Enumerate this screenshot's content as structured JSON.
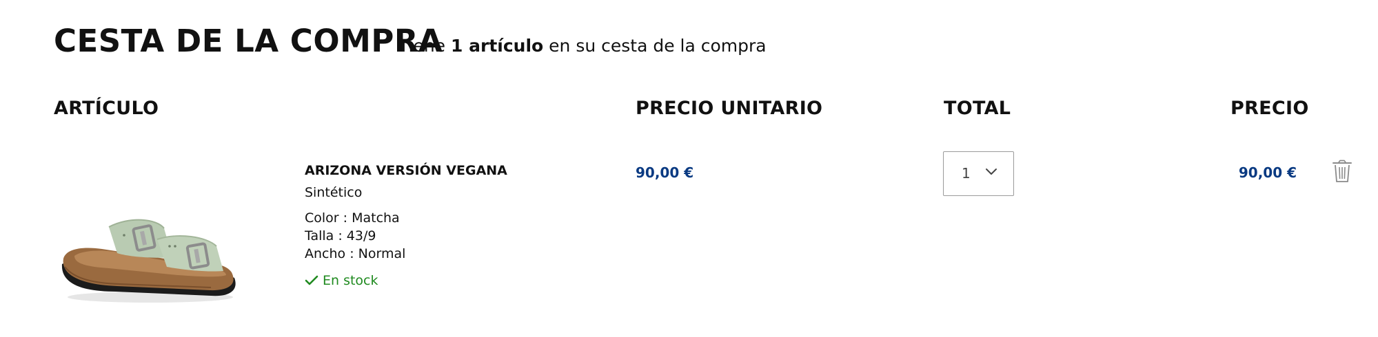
{
  "page": {
    "title": "CESTA DE LA COMPRA",
    "summary_prefix": "Tiene ",
    "summary_count": "1 artículo",
    "summary_suffix": " en su cesta de la compra"
  },
  "table": {
    "headers": {
      "item": "ARTÍCULO",
      "unit_price": "PRECIO UNITARIO",
      "total": "TOTAL",
      "price": "PRECIO"
    }
  },
  "items": [
    {
      "image_icon": "sandal-image",
      "name": "ARIZONA VERSIÓN VEGANA",
      "material": "Sintético",
      "color": "Color : Matcha",
      "size": "Talla : 43/9",
      "width": "Ancho : Normal",
      "stock_icon": "checkmark-icon",
      "stock": "En stock",
      "unit_price": "90,00 €",
      "quantity": "1",
      "price": "90,00 €",
      "delete_icon": "trash-icon"
    }
  ],
  "colors": {
    "price": "#0a3a82",
    "stock": "#1f8a1f",
    "text": "#111111"
  }
}
